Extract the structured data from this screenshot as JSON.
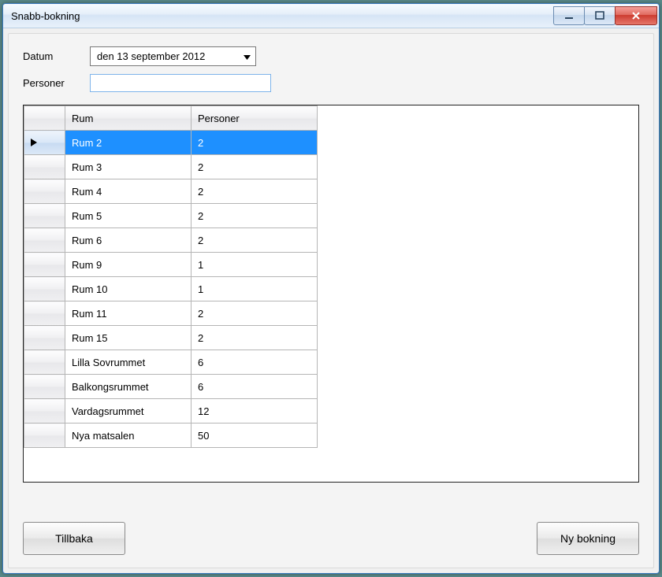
{
  "window": {
    "title": "Snabb-bokning"
  },
  "form": {
    "date_label": "Datum",
    "date_value": "den 13 september 2012",
    "persons_label": "Personer",
    "persons_value": ""
  },
  "grid": {
    "columns": {
      "room": "Rum",
      "persons": "Personer"
    },
    "selected_index": 0,
    "rows": [
      {
        "room": "Rum 2",
        "persons": "2"
      },
      {
        "room": "Rum 3",
        "persons": "2"
      },
      {
        "room": "Rum 4",
        "persons": "2"
      },
      {
        "room": "Rum 5",
        "persons": "2"
      },
      {
        "room": "Rum 6",
        "persons": "2"
      },
      {
        "room": "Rum 9",
        "persons": "1"
      },
      {
        "room": "Rum 10",
        "persons": "1"
      },
      {
        "room": "Rum 11",
        "persons": "2"
      },
      {
        "room": "Rum 15",
        "persons": "2"
      },
      {
        "room": "Lilla Sovrummet",
        "persons": "6"
      },
      {
        "room": "Balkongsrummet",
        "persons": "6"
      },
      {
        "room": "Vardagsrummet",
        "persons": "12"
      },
      {
        "room": "Nya matsalen",
        "persons": "50"
      }
    ]
  },
  "buttons": {
    "back": "Tillbaka",
    "new_booking": "Ny bokning"
  }
}
